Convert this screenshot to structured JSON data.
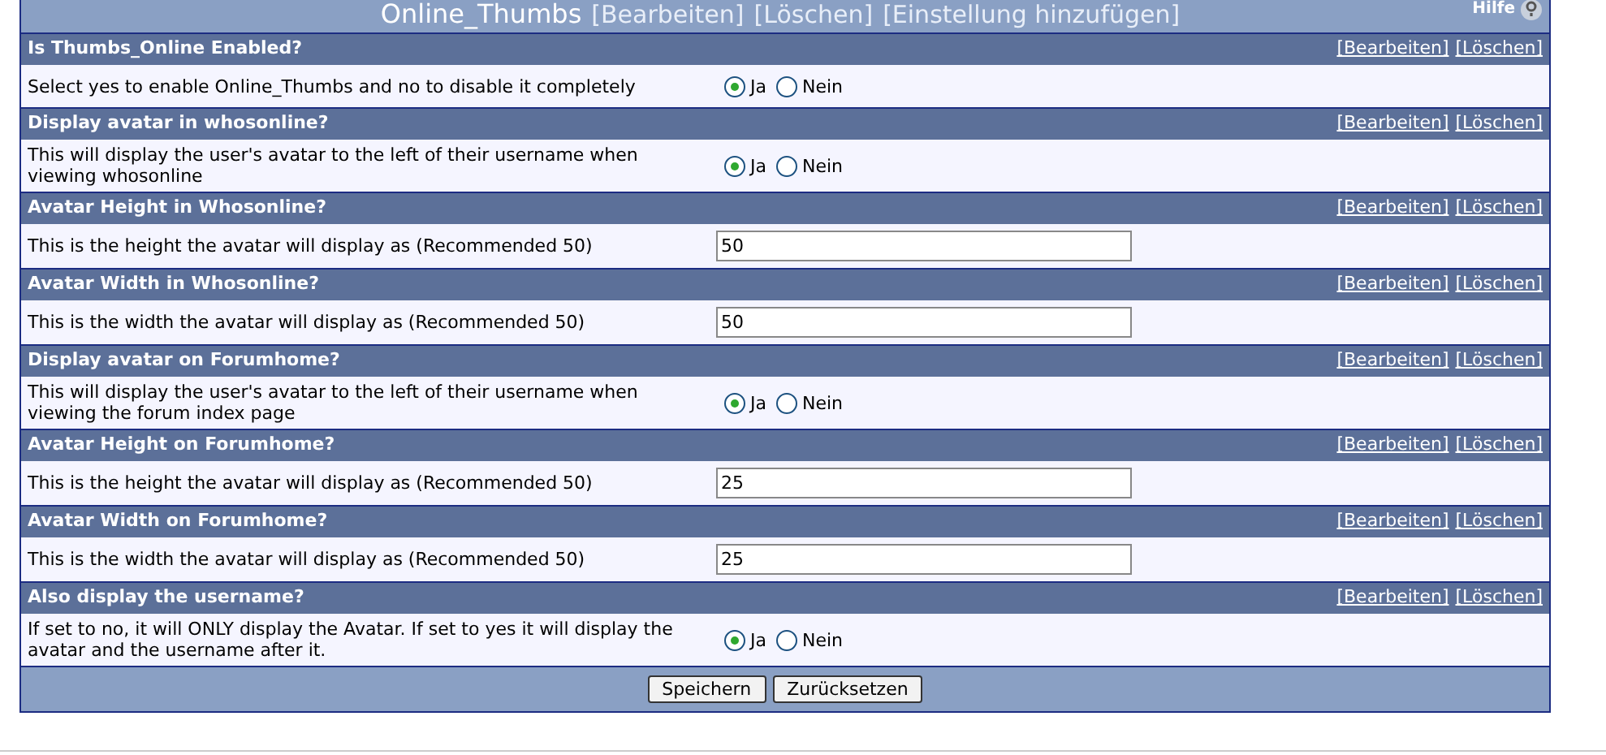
{
  "header": {
    "title": "Online_Thumbs",
    "links": [
      "[Bearbeiten]",
      "[Löschen]",
      "[Einstellung hinzufügen]"
    ],
    "help": "Hilfe"
  },
  "settings": [
    {
      "title": "Is Thumbs_Online Enabled?",
      "actions": [
        "[Bearbeiten]",
        "[Löschen]"
      ],
      "description": "Select yes to enable Online_Thumbs and no to disable it completely",
      "kind": "yesno",
      "options": [
        {
          "label": "Ja",
          "selected": true
        },
        {
          "label": "Nein",
          "selected": false
        }
      ]
    },
    {
      "title": "Display avatar in whosonline?",
      "actions": [
        "[Bearbeiten]",
        "[Löschen]"
      ],
      "description": "This will display the user's avatar to the left of their username when viewing whosonline",
      "kind": "yesno",
      "options": [
        {
          "label": "Ja",
          "selected": true
        },
        {
          "label": "Nein",
          "selected": false
        }
      ]
    },
    {
      "title": "Avatar Height in Whosonline?",
      "actions": [
        "[Bearbeiten]",
        "[Löschen]"
      ],
      "description": "This is the height the avatar will display as (Recommended 50)",
      "kind": "text",
      "value": "50"
    },
    {
      "title": "Avatar Width in Whosonline?",
      "actions": [
        "[Bearbeiten]",
        "[Löschen]"
      ],
      "description": "This is the width the avatar will display as (Recommended 50)",
      "kind": "text",
      "value": "50"
    },
    {
      "title": "Display avatar on Forumhome?",
      "actions": [
        "[Bearbeiten]",
        "[Löschen]"
      ],
      "description": "This will display the user's avatar to the left of their username when viewing the forum index page",
      "kind": "yesno",
      "options": [
        {
          "label": "Ja",
          "selected": true
        },
        {
          "label": "Nein",
          "selected": false
        }
      ]
    },
    {
      "title": "Avatar Height on Forumhome?",
      "actions": [
        "[Bearbeiten]",
        "[Löschen]"
      ],
      "description": "This is the height the avatar will display as (Recommended 50)",
      "kind": "text",
      "value": "25"
    },
    {
      "title": "Avatar Width on Forumhome?",
      "actions": [
        "[Bearbeiten]",
        "[Löschen]"
      ],
      "description": "This is the width the avatar will display as (Recommended 50)",
      "kind": "text",
      "value": "25"
    },
    {
      "title": "Also display the username?",
      "actions": [
        "[Bearbeiten]",
        "[Löschen]"
      ],
      "description": "If set to no, it will ONLY display the Avatar. If set to yes it will display the avatar and the username after it.",
      "kind": "yesno",
      "options": [
        {
          "label": "Ja",
          "selected": true
        },
        {
          "label": "Nein",
          "selected": false
        }
      ]
    }
  ],
  "buttons": [
    "Speichern",
    "Zurücksetzen"
  ]
}
